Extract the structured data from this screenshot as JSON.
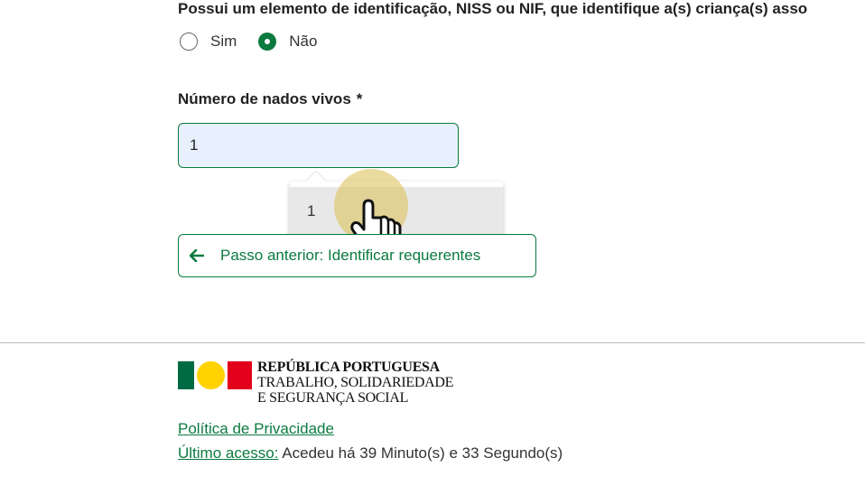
{
  "question": {
    "text": "Possui um elemento de identificação, NISS ou NIF, que identifique a(s) criança(s) asso",
    "options": [
      {
        "label": "Sim",
        "checked": false
      },
      {
        "label": "Não",
        "checked": true
      }
    ]
  },
  "births_field": {
    "label": "Número de nados vivos",
    "required_marker": "*",
    "value": "1"
  },
  "autocomplete": {
    "items": [
      "1"
    ]
  },
  "navigation": {
    "prev_label": "Passo anterior: Identificar requerentes"
  },
  "footer": {
    "logo_line1": "REPÚBLICA PORTUGUESA",
    "logo_line2": "TRABALHO, SOLIDARIEDADE",
    "logo_line3": "E SEGURANÇA SOCIAL",
    "privacy_link": "Política de Privacidade",
    "last_access_label": "Último acesso:",
    "last_access_value": "Acedeu há 39 Minuto(s) e 33 Segundo(s)"
  },
  "colors": {
    "accent_green": "#0b7a3e",
    "input_bg": "#e8f0fe"
  }
}
